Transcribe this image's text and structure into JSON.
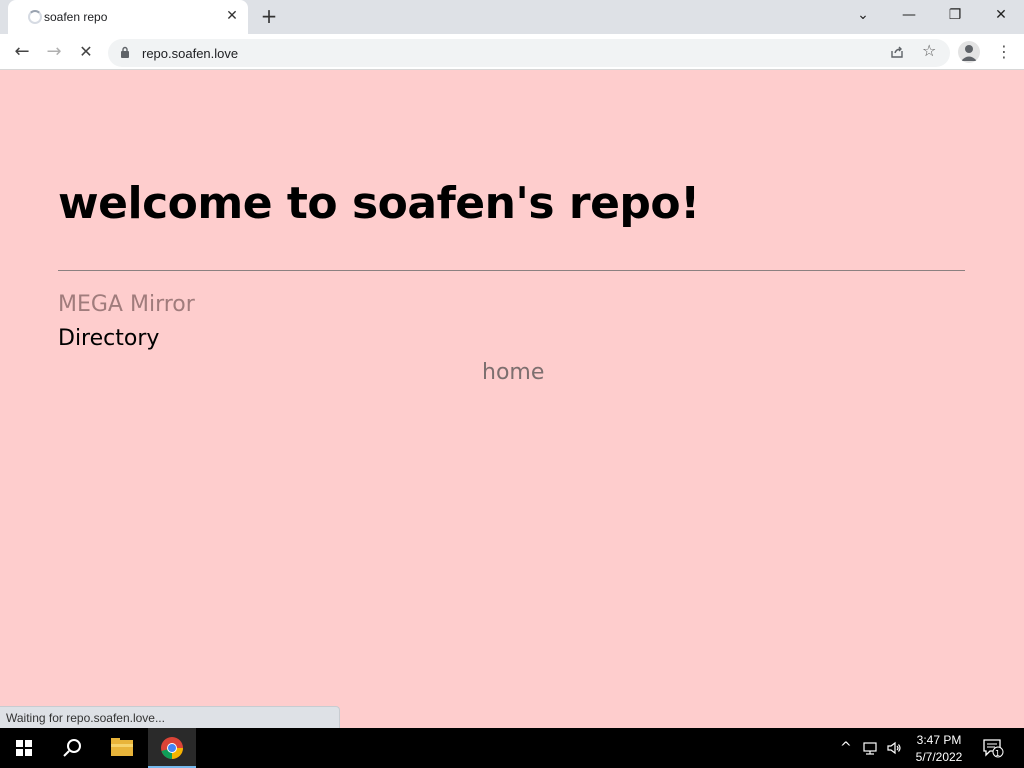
{
  "browser": {
    "tab": {
      "title": "soafen repo",
      "close_glyph": "✕"
    },
    "new_tab_glyph": "+",
    "window_controls": {
      "dropdown": "⌄",
      "minimize": "—",
      "restore": "❐",
      "close": "✕"
    },
    "nav": {
      "back": "←",
      "forward": "→",
      "stop": "✕"
    },
    "url": "repo.soafen.love",
    "star_glyph": "☆",
    "menu_glyph": "⋮"
  },
  "page": {
    "background": "#fecdcd",
    "title": "welcome to soafen's repo!",
    "links": [
      {
        "label": "MEGA Mirror",
        "color": "#a07c7c"
      },
      {
        "label": "Directory",
        "color": "#000000"
      },
      {
        "label": "home",
        "color": "#7d6f6f"
      }
    ]
  },
  "status_bar": {
    "text": "Waiting for repo.soafen.love..."
  },
  "taskbar": {
    "time": "3:47 PM",
    "date": "5/7/2022",
    "notification_count": "1",
    "tray_chevron": "^",
    "icons": [
      "windows-start-icon",
      "search-icon",
      "file-explorer-icon",
      "chrome-icon"
    ]
  }
}
